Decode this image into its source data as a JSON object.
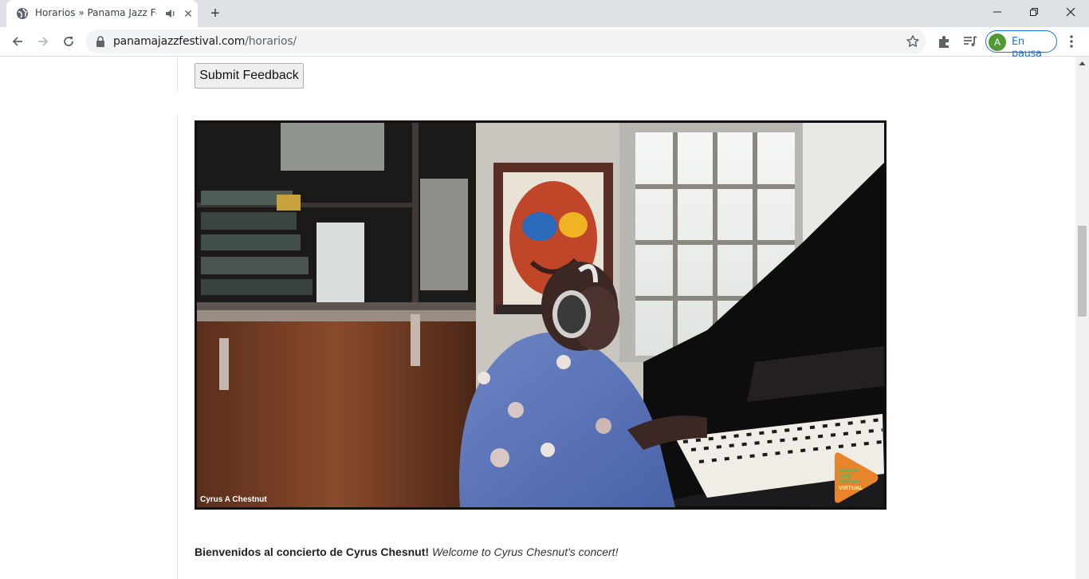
{
  "browser": {
    "tab": {
      "title": "Horarios » Panama Jazz Festi",
      "close_glyph": "✕"
    },
    "new_tab_glyph": "+",
    "address": {
      "host": "panamajazzfestival.com",
      "path": "/horarios/"
    },
    "profile": {
      "initial": "A",
      "label": "En pausa"
    }
  },
  "page": {
    "submit_label": "Submit Feedback",
    "video": {
      "name_tag": "Cyrus A Chestnut",
      "logo": {
        "line1": "PANAMA",
        "line2": "JAZZ",
        "line3": "FESTIVAL",
        "line4": "VIRTUAL"
      }
    },
    "caption": {
      "bold": "Bienvenidos al concierto de Cyrus Chesnut!",
      "italic": "Welcome to Cyrus Chesnut's concert!"
    }
  },
  "colors": {
    "accent": "#1a73e8",
    "logo_orange": "#e8852a",
    "logo_green": "#39c06e"
  }
}
